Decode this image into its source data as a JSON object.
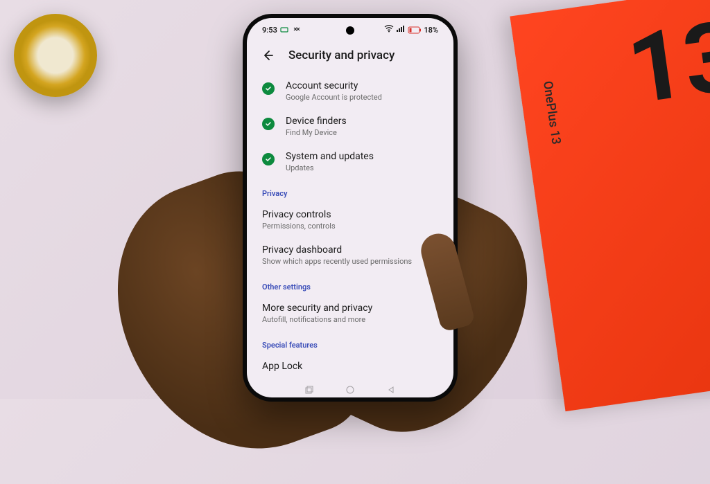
{
  "statusBar": {
    "time": "9:53",
    "batteryPercent": "18%"
  },
  "header": {
    "title": "Security and privacy"
  },
  "securityItems": [
    {
      "title": "Account security",
      "subtitle": "Google Account is protected"
    },
    {
      "title": "Device finders",
      "subtitle": "Find My Device"
    },
    {
      "title": "System and updates",
      "subtitle": "Updates"
    }
  ],
  "sections": {
    "privacy": {
      "header": "Privacy",
      "items": [
        {
          "title": "Privacy controls",
          "subtitle": "Permissions, controls"
        },
        {
          "title": "Privacy dashboard",
          "subtitle": "Show which apps recently used permissions"
        }
      ]
    },
    "otherSettings": {
      "header": "Other settings",
      "items": [
        {
          "title": "More security and privacy",
          "subtitle": "Autofill, notifications and more"
        }
      ]
    },
    "specialFeatures": {
      "header": "Special features",
      "items": [
        {
          "title": "App Lock",
          "subtitle": ""
        }
      ]
    }
  },
  "boxLabel": "OnePlus 13",
  "boxNumber": "13"
}
